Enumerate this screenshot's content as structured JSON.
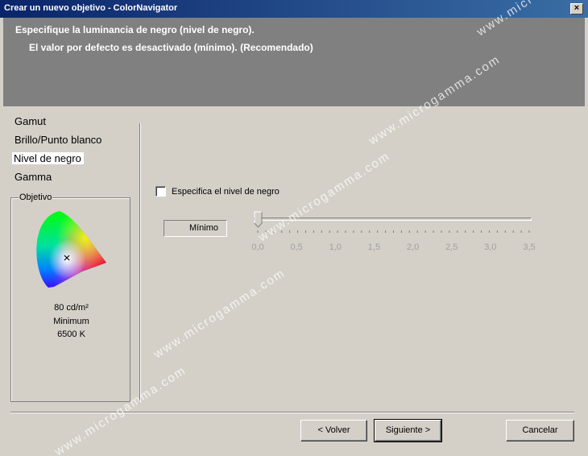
{
  "window": {
    "title": "Crear un nuevo objetivo - ColorNavigator",
    "close_label": "×"
  },
  "banner": {
    "line1": "Especifique la luminancia de negro (nivel de negro).",
    "line2": "El valor por defecto es desactivado (mínimo). (Recomendado)"
  },
  "steps": [
    {
      "label": "Gamut"
    },
    {
      "label": "Brillo/Punto blanco"
    },
    {
      "label": "Nivel de negro",
      "active": true
    },
    {
      "label": "Gamma"
    }
  ],
  "target_group": {
    "legend": "Objetivo",
    "luminance": "80 cd/m²",
    "black_level": "Minimum",
    "white_point": "6500 K"
  },
  "black_level": {
    "checkbox_label": "Especifica el nivel de negro",
    "checked": false,
    "value_display": "Mínimo",
    "slider": {
      "min": 0,
      "max": 3.5,
      "value": 0,
      "step_marks": 34,
      "tick_labels": [
        "0,0",
        "0,5",
        "1,0",
        "1,5",
        "2,0",
        "2,5",
        "3,0",
        "3,5"
      ],
      "disabled": true
    }
  },
  "buttons": {
    "back": "< Volver",
    "next": "Siguiente >",
    "cancel": "Cancelar"
  },
  "watermark_text": "www.microgamma.com"
}
